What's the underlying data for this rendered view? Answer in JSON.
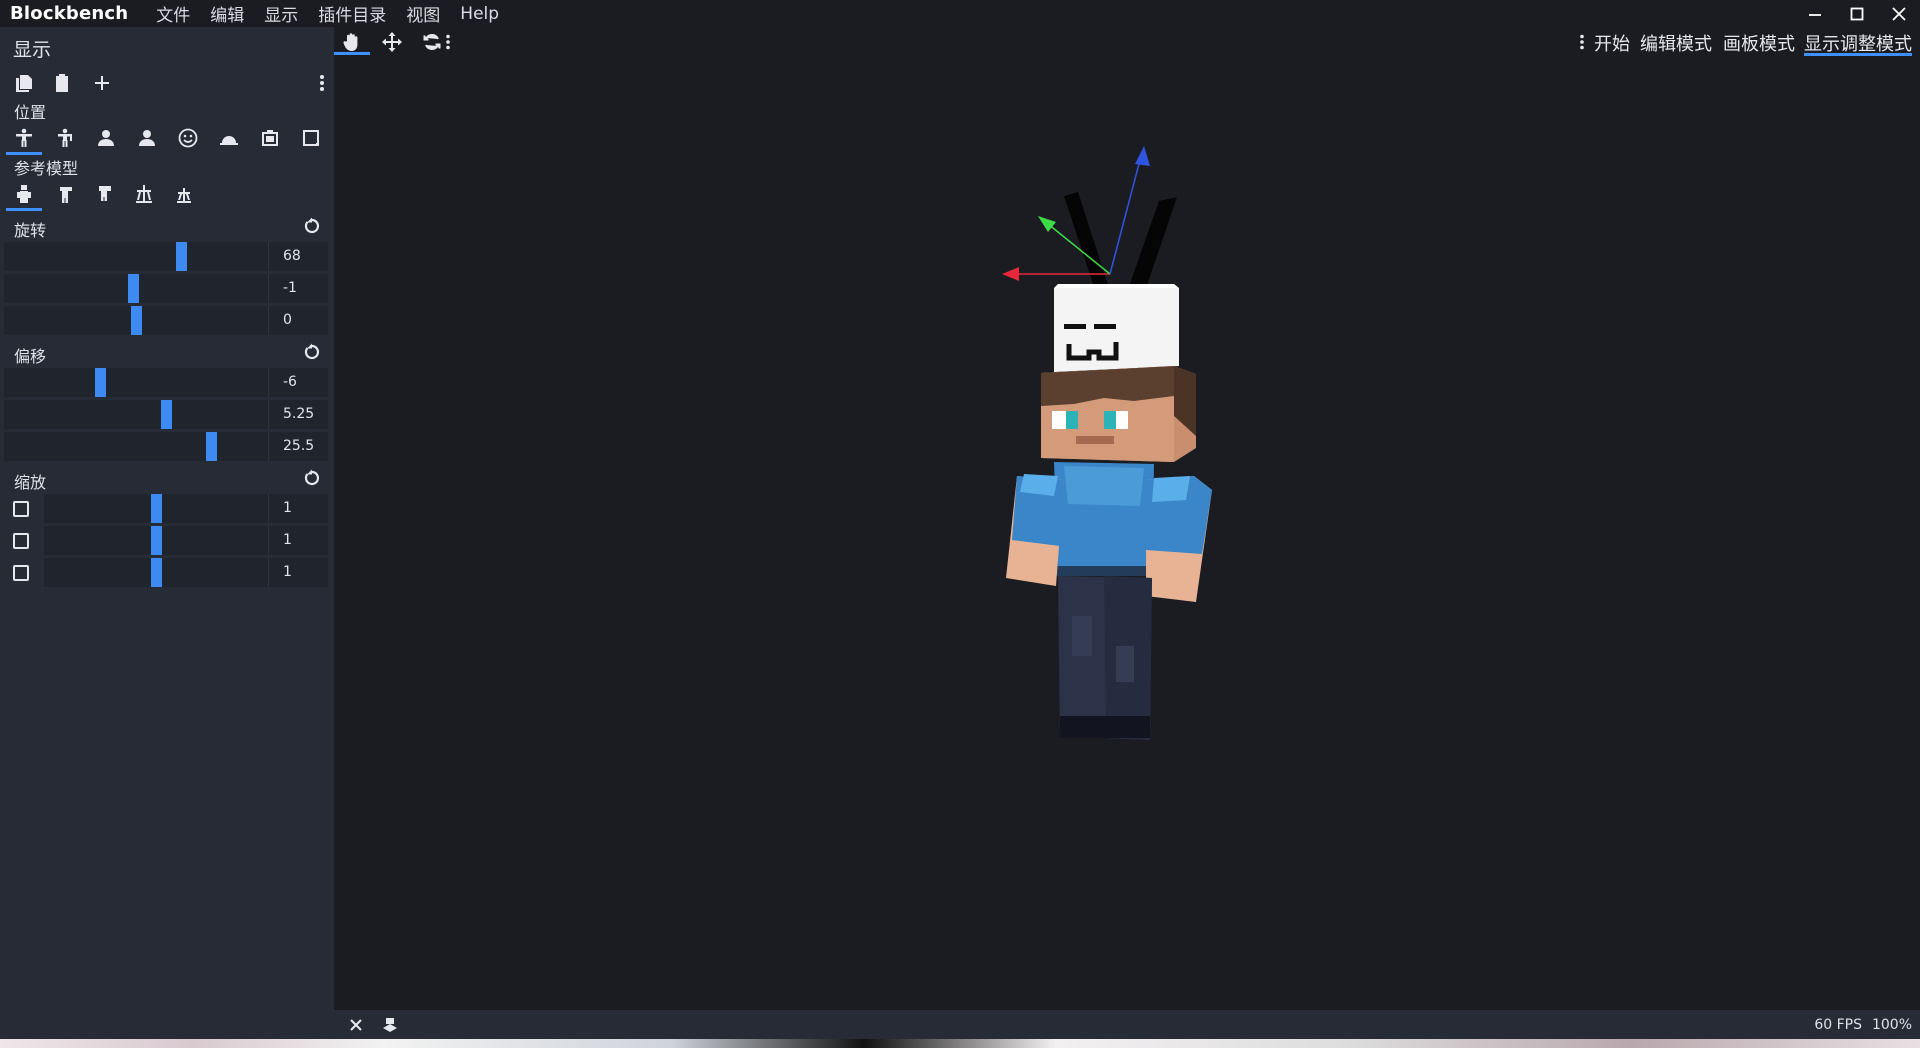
{
  "app": {
    "title": "Blockbench",
    "menu": [
      "文件",
      "编辑",
      "显示",
      "插件目录",
      "视图",
      "Help"
    ]
  },
  "sidebar": {
    "title": "显示",
    "tools": [
      "copy-icon",
      "paste-icon",
      "add-icon",
      "more-vertical-icon"
    ],
    "slot_label": "位置",
    "slots": [
      "thirdperson-right-hand-icon",
      "thirdperson-left-hand-icon",
      "firstperson-right-hand-icon",
      "firstperson-left-hand-icon",
      "head-icon",
      "ground-icon",
      "item-frame-icon",
      "gui-icon"
    ],
    "active_slot": 0,
    "reference_label": "参考模型",
    "references": [
      "player-model-icon",
      "zombie-model-icon",
      "baby-zombie-model-icon",
      "armor-stand-icon",
      "small-armor-stand-icon"
    ],
    "active_reference": 0,
    "rotation": {
      "label": "旋转",
      "values": [
        "68",
        "-1",
        "0"
      ],
      "levels": [
        0.68,
        0.49,
        0.5
      ]
    },
    "translation": {
      "label": "偏移",
      "values": [
        "-6",
        "5.25",
        "25.5"
      ],
      "levels": [
        0.36,
        0.62,
        0.8
      ]
    },
    "scale": {
      "label": "缩放",
      "values": [
        "1",
        "1",
        "1"
      ],
      "levels": [
        0.5,
        0.5,
        0.5
      ],
      "mirrored": [
        false,
        false,
        false
      ]
    }
  },
  "viewport_toolbar": {
    "tools": [
      "move-view-icon",
      "translate-icon",
      "rotate-icon",
      "more-vertical-icon"
    ],
    "active_tool": 0,
    "modes": [
      "开始",
      "编辑模式",
      "画板模式",
      "显示调整模式"
    ],
    "active_mode": 3
  },
  "status": {
    "fps": "60 FPS",
    "zoom": "100%"
  },
  "colors": {
    "accent": "#3e90ff",
    "gizmo_x": "#e8283a",
    "gizmo_y": "#3ddc47",
    "gizmo_z": "#2f55e0",
    "shirt": "#3a86c8",
    "skin": "#e8b394",
    "hair": "#5a3f2e",
    "pants": "#2c3348"
  }
}
